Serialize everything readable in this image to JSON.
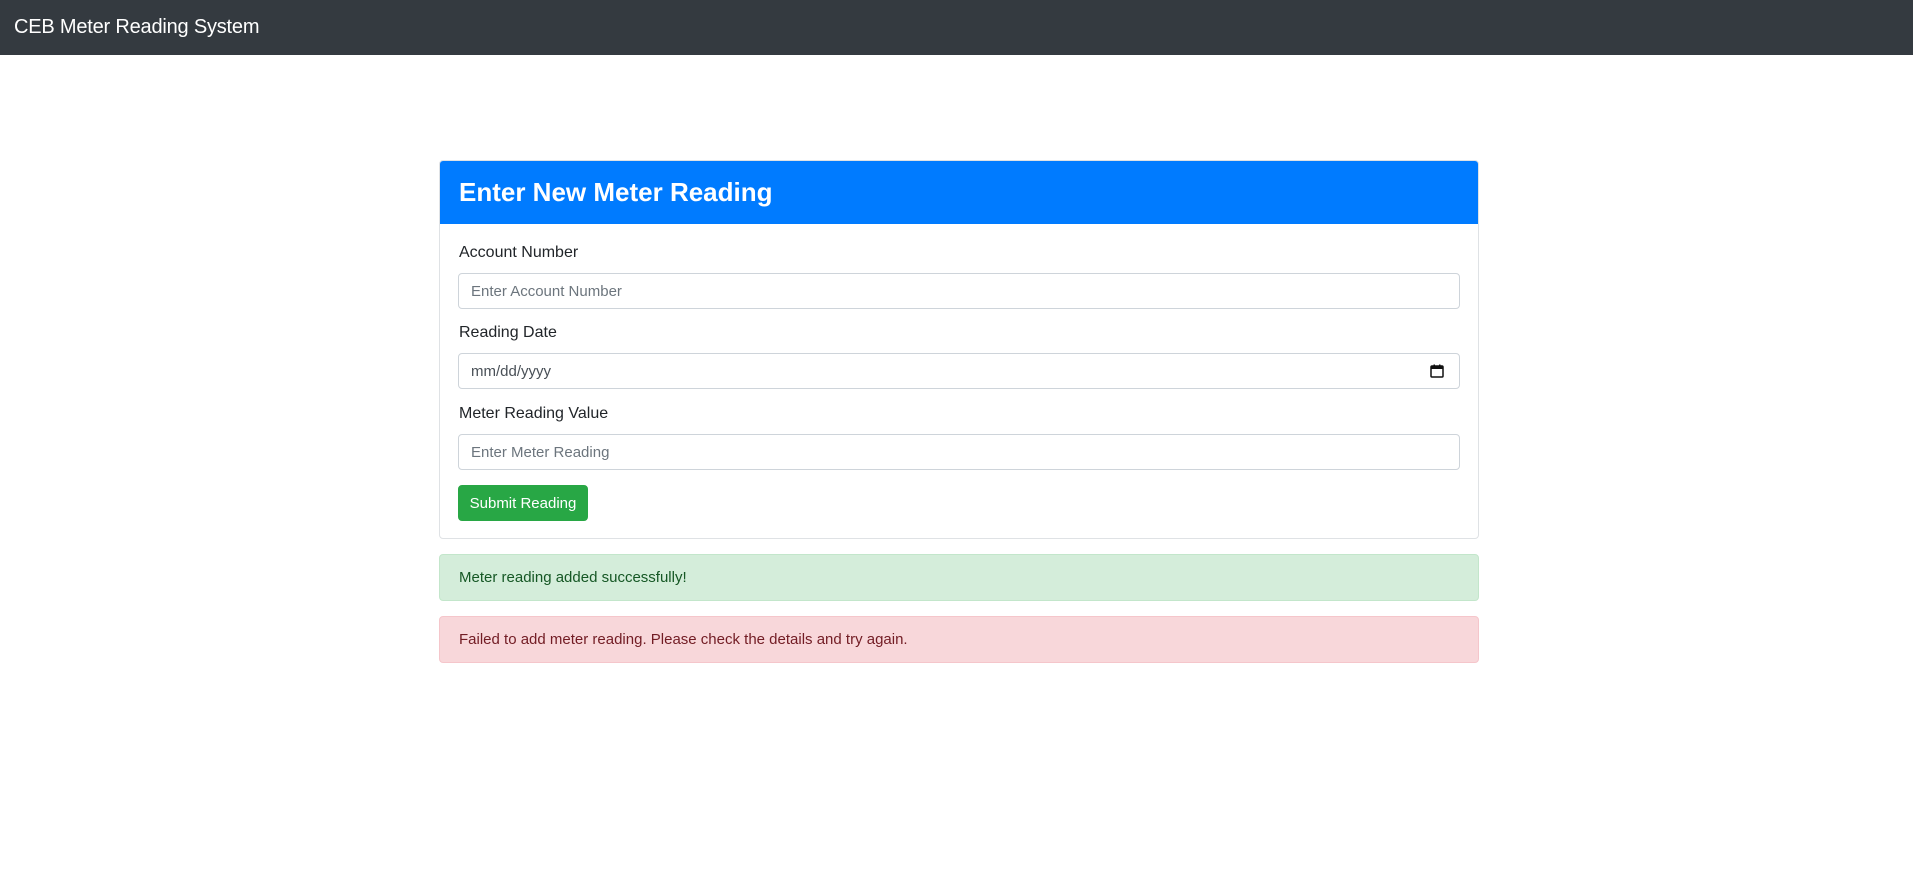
{
  "navbar": {
    "brand": "CEB Meter Reading System",
    "background": "#343a40"
  },
  "card": {
    "title": "Enter New Meter Reading",
    "header_color": "#007bff"
  },
  "form": {
    "account": {
      "label": "Account Number",
      "placeholder": "Enter Account Number",
      "value": ""
    },
    "date": {
      "label": "Reading Date",
      "placeholder": "mm/dd/yyyy",
      "icon": "calendar-icon"
    },
    "reading": {
      "label": "Meter Reading Value",
      "placeholder": "Enter Meter Reading",
      "value": ""
    },
    "submit_label": "Submit Reading",
    "submit_color": "#28a745"
  },
  "alerts": {
    "success": {
      "text": "Meter reading added successfully!",
      "color": "#d4edda"
    },
    "error": {
      "text": "Failed to add meter reading. Please check the details and try again.",
      "color": "#f8d7da"
    }
  }
}
